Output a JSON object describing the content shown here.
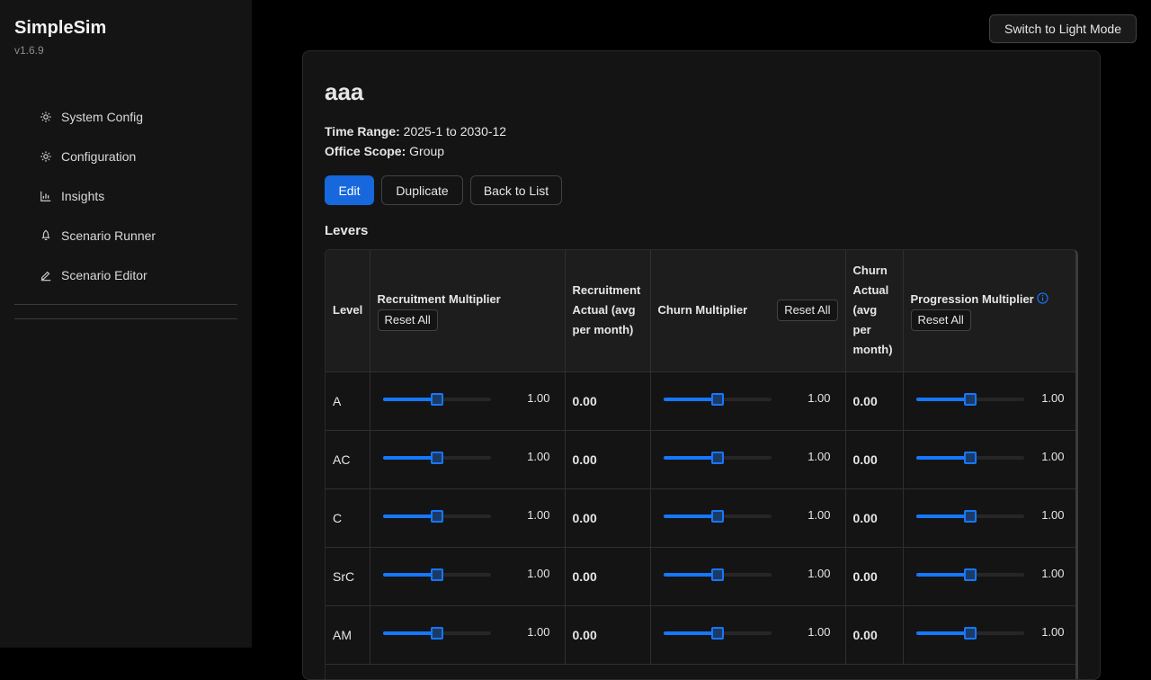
{
  "sidebar": {
    "brand": "SimpleSim",
    "version": "v1.6.9",
    "items": [
      {
        "label": "System Config",
        "icon": "gear-icon"
      },
      {
        "label": "Configuration",
        "icon": "gear-icon"
      },
      {
        "label": "Insights",
        "icon": "bar-chart-icon"
      },
      {
        "label": "Scenario Runner",
        "icon": "rocket-icon"
      },
      {
        "label": "Scenario Editor",
        "icon": "edit-icon"
      }
    ]
  },
  "header": {
    "theme_button": "Switch to Light Mode"
  },
  "scenario": {
    "title": "aaa",
    "time_range_label": "Time Range:",
    "time_range": "2025-1 to 2030-12",
    "office_scope_label": "Office Scope:",
    "office_scope": "Group"
  },
  "actions": {
    "edit": "Edit",
    "duplicate": "Duplicate",
    "back": "Back to List"
  },
  "levers": {
    "title": "Levers",
    "columns": {
      "level": "Level",
      "recruitment_multiplier": "Recruitment Multiplier",
      "recruitment_actual": "Recruitment Actual (avg per month)",
      "churn_multiplier": "Churn Multiplier",
      "churn_actual": "Churn Actual (avg per month)",
      "progression_multiplier": "Progression Multiplier",
      "reset_all": "Reset All"
    },
    "rows": [
      {
        "level": "A",
        "recruitment": "1.00",
        "recruitment_actual": "0.00",
        "churn": "1.00",
        "churn_actual": "0.00",
        "progression": "1.00"
      },
      {
        "level": "AC",
        "recruitment": "1.00",
        "recruitment_actual": "0.00",
        "churn": "1.00",
        "churn_actual": "0.00",
        "progression": "1.00"
      },
      {
        "level": "C",
        "recruitment": "1.00",
        "recruitment_actual": "0.00",
        "churn": "1.00",
        "churn_actual": "0.00",
        "progression": "1.00"
      },
      {
        "level": "SrC",
        "recruitment": "1.00",
        "recruitment_actual": "0.00",
        "churn": "1.00",
        "churn_actual": "0.00",
        "progression": "1.00"
      },
      {
        "level": "AM",
        "recruitment": "1.00",
        "recruitment_actual": "0.00",
        "churn": "1.00",
        "churn_actual": "0.00",
        "progression": "1.00"
      }
    ],
    "slider_level": 0.5
  },
  "colors": {
    "accent": "#1677ff",
    "primary_button": "#1668dc",
    "background": "#000000",
    "panel": "#141414"
  }
}
